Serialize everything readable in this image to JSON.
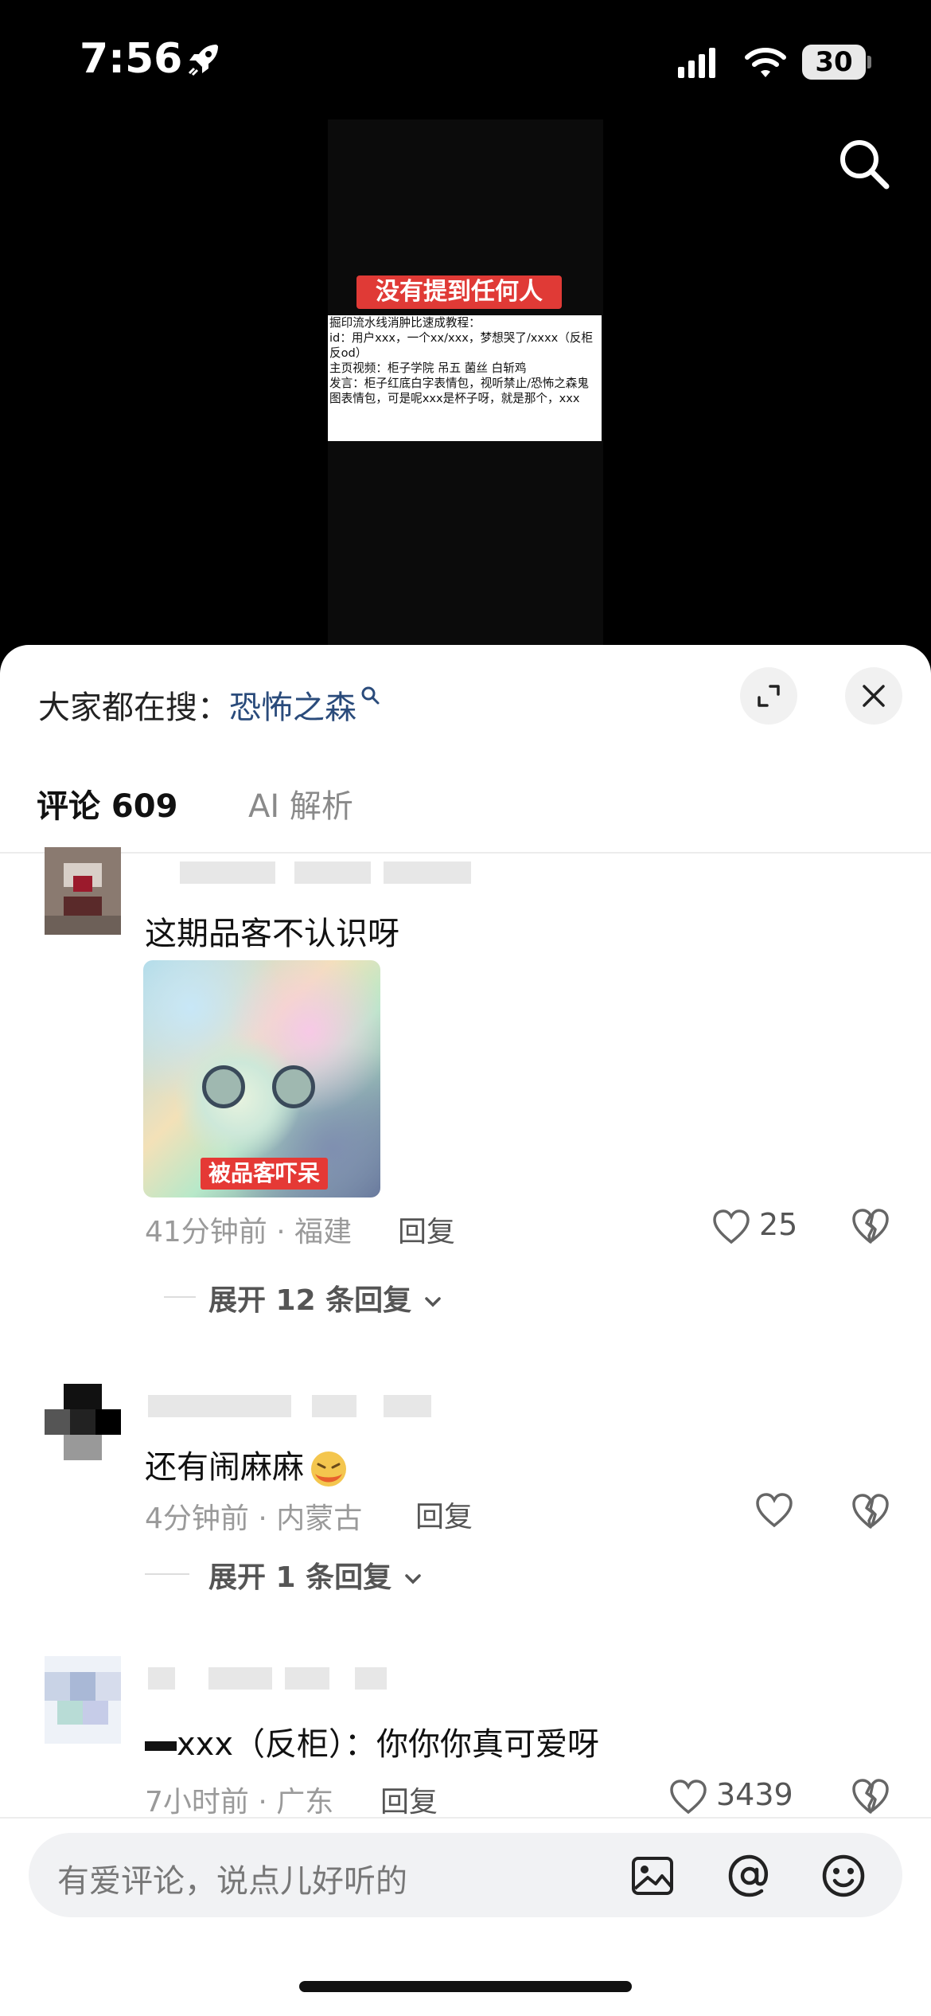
{
  "status_bar": {
    "time": "7:56",
    "battery": "30"
  },
  "video": {
    "banner": "没有提到任何人",
    "note_lines": [
      "掘印流水线消肿比速成教程：",
      "id：用户xxx，一个xx/xxx，梦想哭了/xxxx（反柜反od）",
      "主页视频：柜子学院 吊五 菌丝 白斩鸡",
      "发言：柜子红底白字表情包，视听禁止/恐怖之森鬼图表情包，可是呢xxx是杯子呀，就是那个，xxx"
    ]
  },
  "sheet": {
    "search_hint_prefix": "大家都在搜：",
    "search_hint_keyword": "恐怖之森",
    "tabs": {
      "comments": "评论 609",
      "ai": "AI 解析"
    }
  },
  "comments": [
    {
      "text": "这期品客不认识呀",
      "sticker_caption": "被品客吓呆",
      "meta": "41分钟前 · 福建",
      "reply": "回复",
      "likes": "25",
      "expand": "展开 12 条回复"
    },
    {
      "text": "还有闹麻麻",
      "meta": "4分钟前 · 内蒙古",
      "reply": "回复",
      "likes": "",
      "expand": "展开 1 条回复"
    },
    {
      "text": "xxx（反柜）：你你你真可爱呀",
      "meta": "7小时前 · 广东",
      "reply": "回复",
      "likes": "3439"
    }
  ],
  "input": {
    "placeholder": "有爱评论，说点儿好听的"
  },
  "icons": {
    "rocket": "rocket-icon",
    "signal": "signal-icon",
    "wifi": "wifi-icon",
    "search": "search-icon",
    "expand": "expand-icon",
    "close": "close-icon",
    "heart": "heart-icon",
    "broken_heart": "broken-heart-icon",
    "chevron": "chevron-down-icon",
    "image": "image-icon",
    "at": "at-icon",
    "emoji": "emoji-icon"
  }
}
